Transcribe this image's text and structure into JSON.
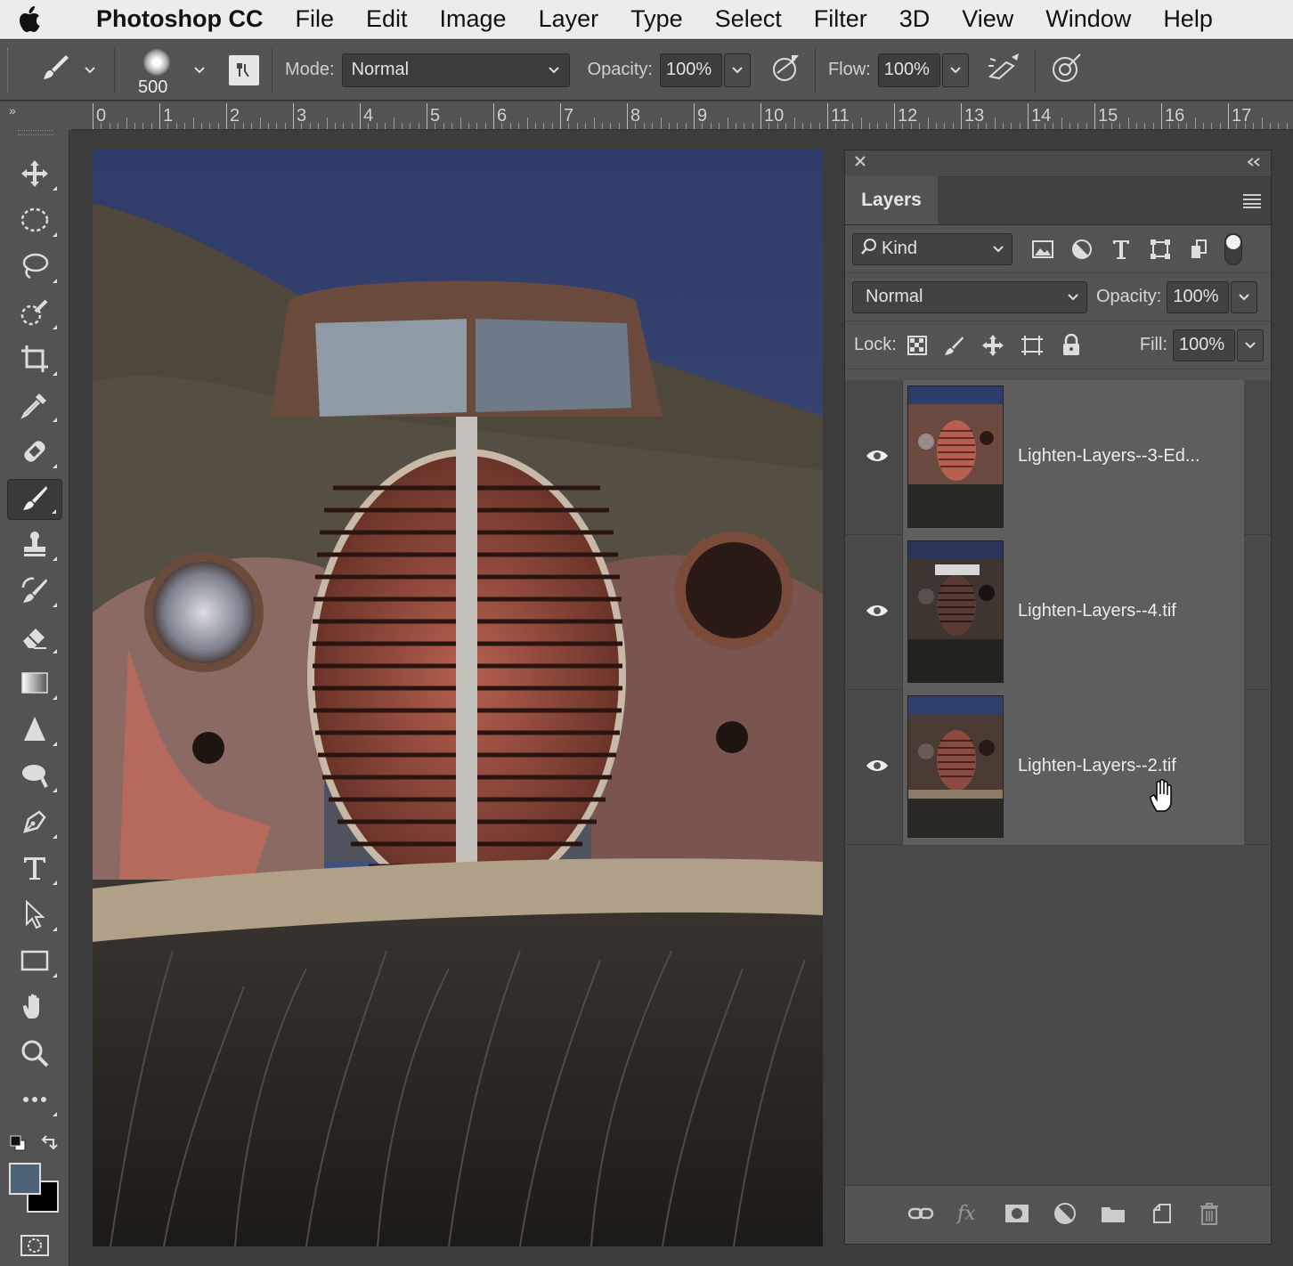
{
  "menubar": {
    "app_name": "Photoshop CC",
    "items": [
      "File",
      "Edit",
      "Image",
      "Layer",
      "Type",
      "Select",
      "Filter",
      "3D",
      "View",
      "Window",
      "Help"
    ]
  },
  "options_bar": {
    "brush_size": "500",
    "mode_label": "Mode:",
    "mode_value": "Normal",
    "opacity_label": "Opacity:",
    "opacity_value": "100%",
    "flow_label": "Flow:",
    "flow_value": "100%"
  },
  "ruler": {
    "corner_glyph": "»",
    "labels": [
      "0",
      "1",
      "2",
      "3",
      "4",
      "5",
      "6",
      "7",
      "8",
      "9",
      "10",
      "11",
      "12",
      "13",
      "14",
      "15",
      "16",
      "17"
    ]
  },
  "toolbar": {
    "tools": [
      "move-icon",
      "marquee-icon",
      "lasso-icon",
      "quick-select-icon",
      "crop-icon",
      "eyedropper-icon",
      "healing-brush-icon",
      "brush-icon",
      "clone-stamp-icon",
      "history-brush-icon",
      "eraser-icon",
      "gradient-icon",
      "sharpen-icon",
      "dodge-icon",
      "pen-icon",
      "type-icon",
      "path-selection-icon",
      "rectangle-icon",
      "hand-icon",
      "zoom-icon",
      "more-tools-icon"
    ],
    "active_tool": "brush-icon",
    "foreground_color": "#4d6478",
    "background_color": "#000000"
  },
  "layers_panel": {
    "tab_label": "Layers",
    "kind_label": "Kind",
    "blend_mode": "Normal",
    "opacity_label": "Opacity:",
    "opacity_value": "100%",
    "lock_label": "Lock:",
    "fill_label": "Fill:",
    "fill_value": "100%",
    "layers": [
      {
        "name": "Lighten-Layers--3-Ed...",
        "visible": true
      },
      {
        "name": "Lighten-Layers--4.tif",
        "visible": true
      },
      {
        "name": "Lighten-Layers--2.tif",
        "visible": true
      }
    ]
  },
  "colors": {
    "menubar_bg": "#ececec",
    "chrome_bg": "#535353",
    "dark_bg": "#3c3c3c"
  }
}
